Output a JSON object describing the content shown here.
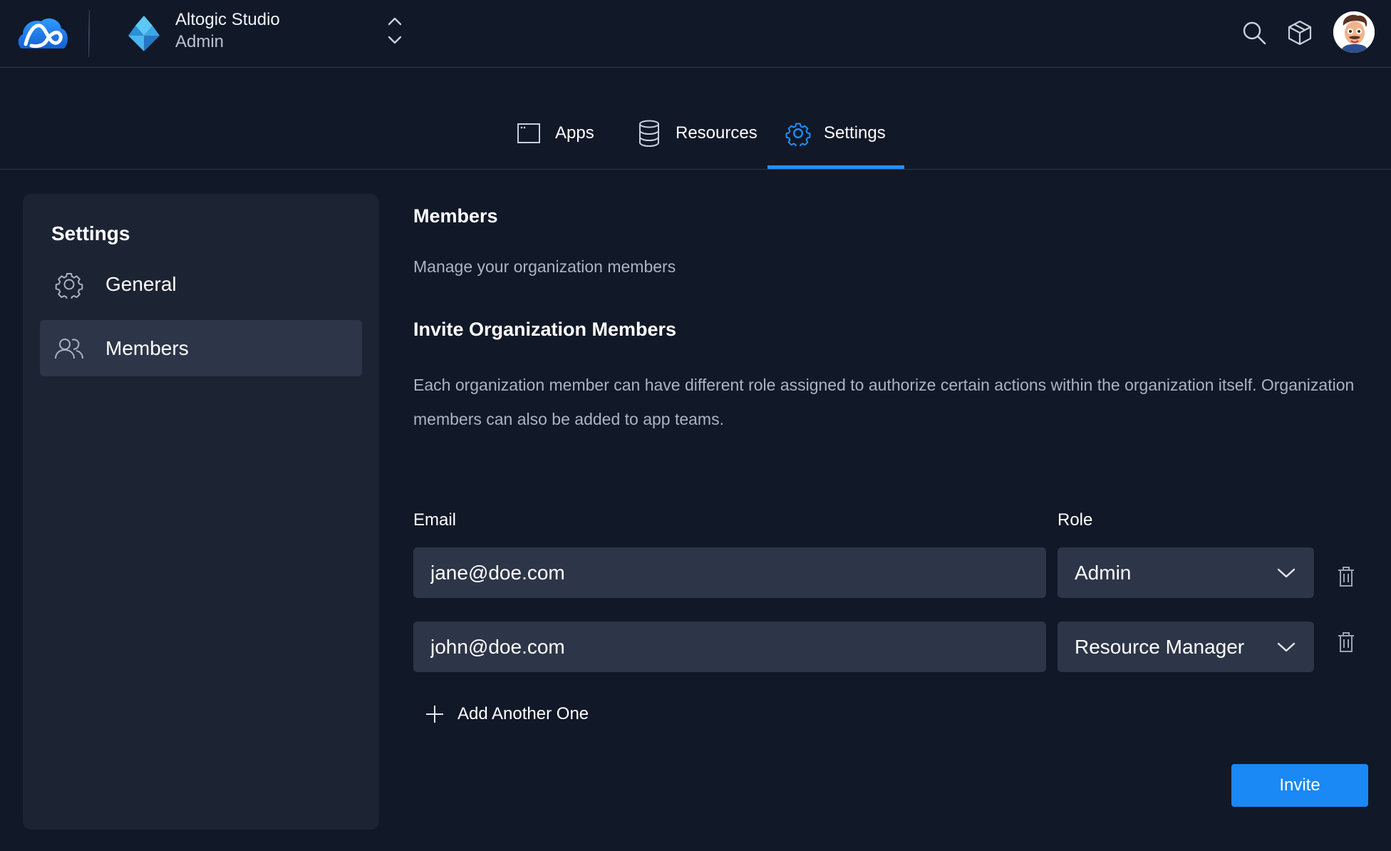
{
  "header": {
    "org_name": "Altogic Studio",
    "org_role": "Admin",
    "logo_icon": "altogic-logo-icon",
    "org_icon": "diamond-org-icon",
    "search_icon": "search-icon",
    "box_icon": "package-icon",
    "avatar_icon": "user-avatar"
  },
  "tabs": [
    {
      "label": "Apps",
      "icon": "window-icon"
    },
    {
      "label": "Resources",
      "icon": "database-icon"
    },
    {
      "label": "Settings",
      "icon": "gear-icon",
      "active": true
    }
  ],
  "sidebar": {
    "title": "Settings",
    "items": [
      {
        "label": "General",
        "icon": "gear-icon"
      },
      {
        "label": "Members",
        "icon": "users-icon",
        "active": true
      }
    ]
  },
  "main": {
    "title": "Members",
    "subtitle": "Manage your organization members",
    "invite_title": "Invite Organization Members",
    "invite_desc": "Each organization member can have different role assigned to authorize certain actions within the organization itself. Organization members can also be added to app teams.",
    "email_label": "Email",
    "role_label": "Role",
    "rows": [
      {
        "email": "jane@doe.com",
        "role": "Admin"
      },
      {
        "email": "john@doe.com",
        "role": "Resource Manager"
      }
    ],
    "add_label": "Add Another One",
    "invite_label": "Invite"
  },
  "colors": {
    "background": "#111827",
    "panel": "#1c2333",
    "input": "#2d3548",
    "accent": "#1e90ff",
    "button": "#1a88f5"
  }
}
